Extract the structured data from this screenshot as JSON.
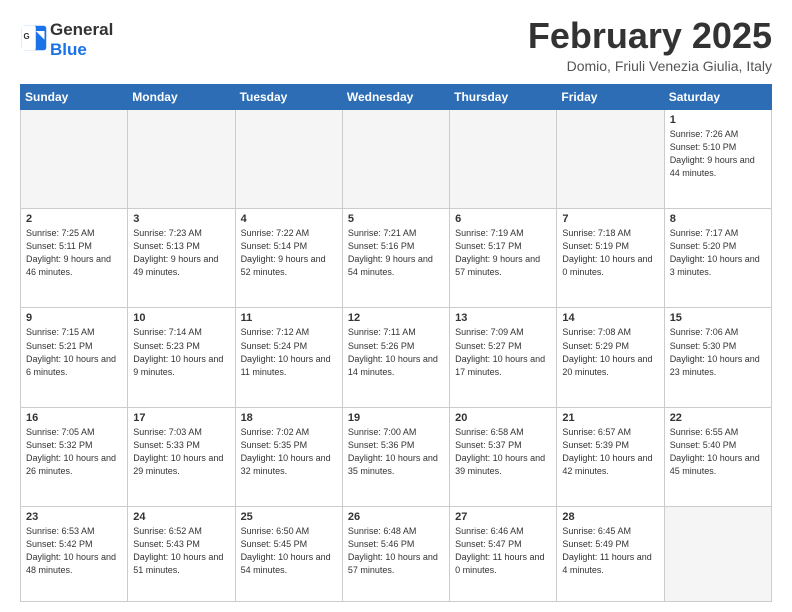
{
  "header": {
    "logo_line1": "General",
    "logo_line2": "Blue",
    "month": "February 2025",
    "location": "Domio, Friuli Venezia Giulia, Italy"
  },
  "weekdays": [
    "Sunday",
    "Monday",
    "Tuesday",
    "Wednesday",
    "Thursday",
    "Friday",
    "Saturday"
  ],
  "weeks": [
    [
      {
        "day": "",
        "info": ""
      },
      {
        "day": "",
        "info": ""
      },
      {
        "day": "",
        "info": ""
      },
      {
        "day": "",
        "info": ""
      },
      {
        "day": "",
        "info": ""
      },
      {
        "day": "",
        "info": ""
      },
      {
        "day": "1",
        "info": "Sunrise: 7:26 AM\nSunset: 5:10 PM\nDaylight: 9 hours and 44 minutes."
      }
    ],
    [
      {
        "day": "2",
        "info": "Sunrise: 7:25 AM\nSunset: 5:11 PM\nDaylight: 9 hours and 46 minutes."
      },
      {
        "day": "3",
        "info": "Sunrise: 7:23 AM\nSunset: 5:13 PM\nDaylight: 9 hours and 49 minutes."
      },
      {
        "day": "4",
        "info": "Sunrise: 7:22 AM\nSunset: 5:14 PM\nDaylight: 9 hours and 52 minutes."
      },
      {
        "day": "5",
        "info": "Sunrise: 7:21 AM\nSunset: 5:16 PM\nDaylight: 9 hours and 54 minutes."
      },
      {
        "day": "6",
        "info": "Sunrise: 7:19 AM\nSunset: 5:17 PM\nDaylight: 9 hours and 57 minutes."
      },
      {
        "day": "7",
        "info": "Sunrise: 7:18 AM\nSunset: 5:19 PM\nDaylight: 10 hours and 0 minutes."
      },
      {
        "day": "8",
        "info": "Sunrise: 7:17 AM\nSunset: 5:20 PM\nDaylight: 10 hours and 3 minutes."
      }
    ],
    [
      {
        "day": "9",
        "info": "Sunrise: 7:15 AM\nSunset: 5:21 PM\nDaylight: 10 hours and 6 minutes."
      },
      {
        "day": "10",
        "info": "Sunrise: 7:14 AM\nSunset: 5:23 PM\nDaylight: 10 hours and 9 minutes."
      },
      {
        "day": "11",
        "info": "Sunrise: 7:12 AM\nSunset: 5:24 PM\nDaylight: 10 hours and 11 minutes."
      },
      {
        "day": "12",
        "info": "Sunrise: 7:11 AM\nSunset: 5:26 PM\nDaylight: 10 hours and 14 minutes."
      },
      {
        "day": "13",
        "info": "Sunrise: 7:09 AM\nSunset: 5:27 PM\nDaylight: 10 hours and 17 minutes."
      },
      {
        "day": "14",
        "info": "Sunrise: 7:08 AM\nSunset: 5:29 PM\nDaylight: 10 hours and 20 minutes."
      },
      {
        "day": "15",
        "info": "Sunrise: 7:06 AM\nSunset: 5:30 PM\nDaylight: 10 hours and 23 minutes."
      }
    ],
    [
      {
        "day": "16",
        "info": "Sunrise: 7:05 AM\nSunset: 5:32 PM\nDaylight: 10 hours and 26 minutes."
      },
      {
        "day": "17",
        "info": "Sunrise: 7:03 AM\nSunset: 5:33 PM\nDaylight: 10 hours and 29 minutes."
      },
      {
        "day": "18",
        "info": "Sunrise: 7:02 AM\nSunset: 5:35 PM\nDaylight: 10 hours and 32 minutes."
      },
      {
        "day": "19",
        "info": "Sunrise: 7:00 AM\nSunset: 5:36 PM\nDaylight: 10 hours and 35 minutes."
      },
      {
        "day": "20",
        "info": "Sunrise: 6:58 AM\nSunset: 5:37 PM\nDaylight: 10 hours and 39 minutes."
      },
      {
        "day": "21",
        "info": "Sunrise: 6:57 AM\nSunset: 5:39 PM\nDaylight: 10 hours and 42 minutes."
      },
      {
        "day": "22",
        "info": "Sunrise: 6:55 AM\nSunset: 5:40 PM\nDaylight: 10 hours and 45 minutes."
      }
    ],
    [
      {
        "day": "23",
        "info": "Sunrise: 6:53 AM\nSunset: 5:42 PM\nDaylight: 10 hours and 48 minutes."
      },
      {
        "day": "24",
        "info": "Sunrise: 6:52 AM\nSunset: 5:43 PM\nDaylight: 10 hours and 51 minutes."
      },
      {
        "day": "25",
        "info": "Sunrise: 6:50 AM\nSunset: 5:45 PM\nDaylight: 10 hours and 54 minutes."
      },
      {
        "day": "26",
        "info": "Sunrise: 6:48 AM\nSunset: 5:46 PM\nDaylight: 10 hours and 57 minutes."
      },
      {
        "day": "27",
        "info": "Sunrise: 6:46 AM\nSunset: 5:47 PM\nDaylight: 11 hours and 0 minutes."
      },
      {
        "day": "28",
        "info": "Sunrise: 6:45 AM\nSunset: 5:49 PM\nDaylight: 11 hours and 4 minutes."
      },
      {
        "day": "",
        "info": ""
      }
    ]
  ]
}
